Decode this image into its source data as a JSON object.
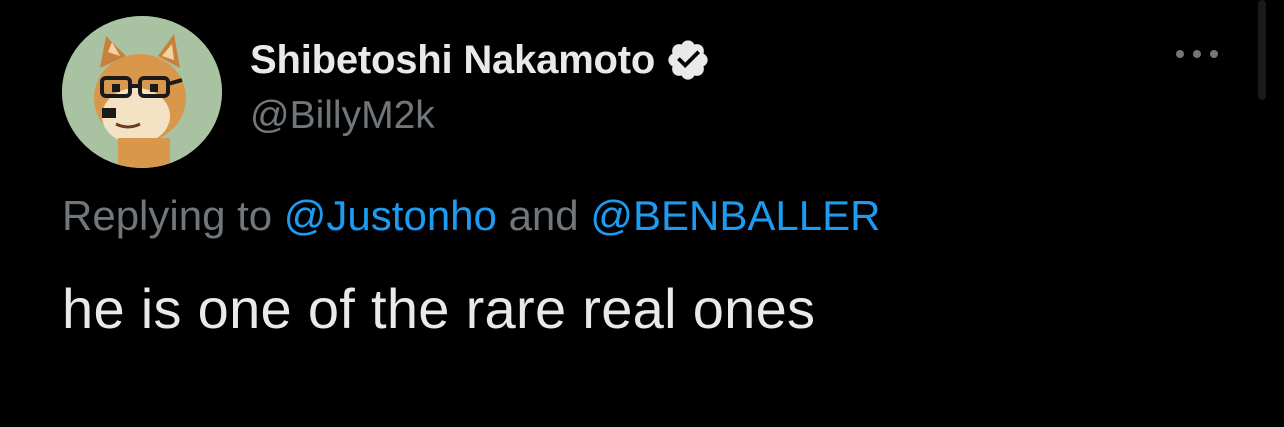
{
  "tweet": {
    "author": {
      "display_name": "Shibetoshi Nakamoto",
      "handle": "@BillyM2k",
      "verified": true,
      "avatar_icon": "shiba-inu-with-glasses-avatar"
    },
    "reply": {
      "prefix": "Replying to ",
      "mentions": [
        "@Justonho",
        "@BENBALLER"
      ],
      "joiner": " and "
    },
    "text": "he is one of the rare real ones",
    "more_icon": "more-dots-icon"
  },
  "colors": {
    "background": "#000000",
    "primary_text": "#e7e9ea",
    "secondary_text": "#71767b",
    "accent": "#1d9bf0",
    "avatar_bg": "#a8c2a2"
  }
}
